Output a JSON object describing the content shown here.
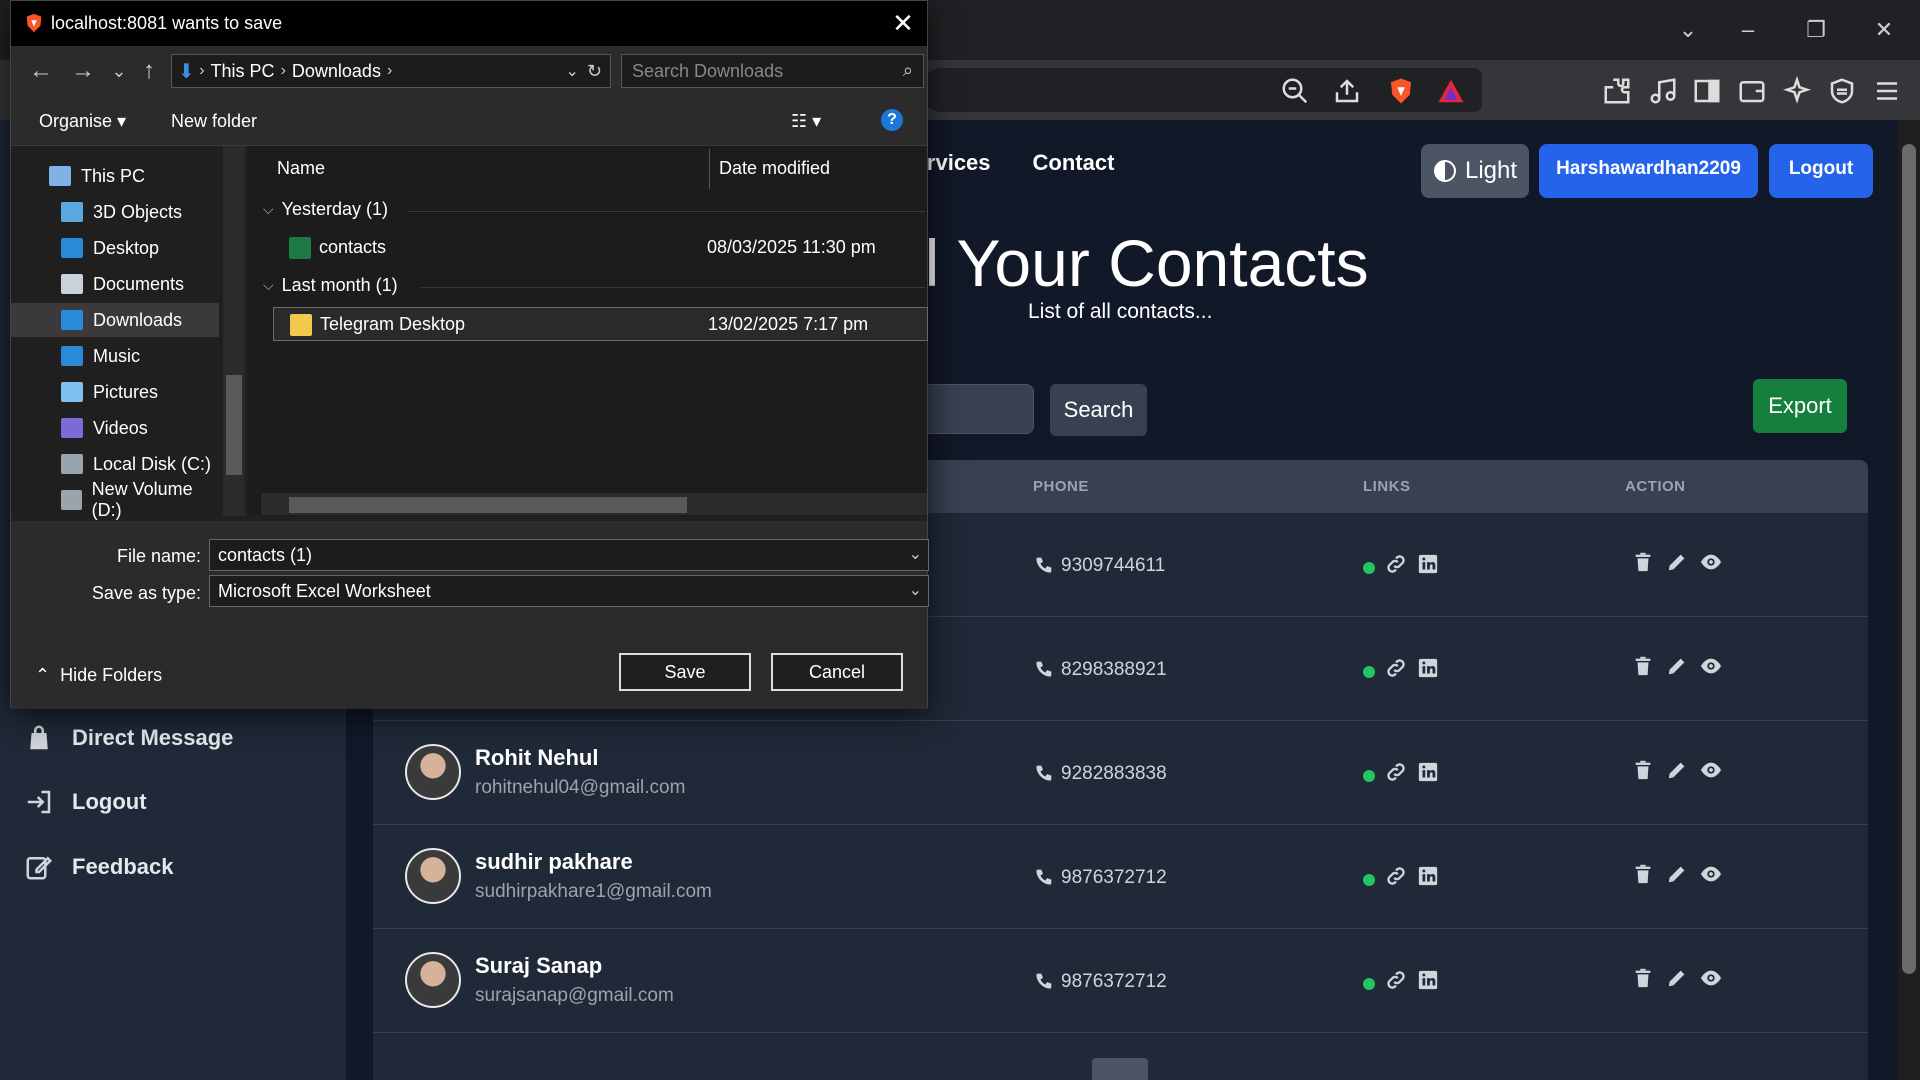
{
  "dialog": {
    "title": "localhost:8081 wants to save",
    "breadcrumb": [
      "This PC",
      "Downloads"
    ],
    "search_placeholder": "Search Downloads",
    "organise_label": "Organise",
    "new_folder_label": "New folder",
    "help_label": "?",
    "nav_items": [
      {
        "label": "This PC",
        "icon": "computer-icon"
      },
      {
        "label": "3D Objects",
        "icon": "3d-objects-icon"
      },
      {
        "label": "Desktop",
        "icon": "desktop-icon"
      },
      {
        "label": "Documents",
        "icon": "documents-icon"
      },
      {
        "label": "Downloads",
        "icon": "downloads-icon"
      },
      {
        "label": "Music",
        "icon": "music-icon"
      },
      {
        "label": "Pictures",
        "icon": "pictures-icon"
      },
      {
        "label": "Videos",
        "icon": "videos-icon"
      },
      {
        "label": "Local Disk (C:)",
        "icon": "drive-icon"
      },
      {
        "label": "New Volume (D:)",
        "icon": "drive-icon"
      }
    ],
    "columns": {
      "name": "Name",
      "date": "Date modified"
    },
    "groups": [
      {
        "label": "Yesterday (1)",
        "files": [
          {
            "name": "contacts",
            "date": "08/03/2025 11:30 pm",
            "icon": "excel-file-icon"
          }
        ]
      },
      {
        "label": "Last month (1)",
        "files": [
          {
            "name": "Telegram Desktop",
            "date": "13/02/2025 7:17 pm",
            "icon": "folder-icon"
          }
        ]
      }
    ],
    "file_name_label": "File name:",
    "file_name_value": "contacts (1)",
    "save_type_label": "Save as type:",
    "save_type_value": "Microsoft Excel Worksheet",
    "save_label": "Save",
    "cancel_label": "Cancel",
    "hide_folders_label": "Hide Folders"
  },
  "app": {
    "nav": {
      "services": "Services",
      "contact": "Contact"
    },
    "theme_label": "Light",
    "user_label": "Harshawardhan2209",
    "logout_label": "Logout",
    "page_title": "ll Your Contacts",
    "page_subtitle": "List of all contacts...",
    "search_label": "Search",
    "export_label": "Export",
    "table_headers": {
      "phone": "PHONE",
      "links": "LINKS",
      "action": "ACTION"
    },
    "sidebar": [
      {
        "label": "Direct Message",
        "icon": "message-icon"
      },
      {
        "label": "Logout",
        "icon": "logout-icon"
      },
      {
        "label": "Feedback",
        "icon": "feedback-icon"
      }
    ],
    "contacts": [
      {
        "name": "",
        "email": "",
        "phone": "9309744611"
      },
      {
        "name": "",
        "email": "",
        "phone": "8298388921"
      },
      {
        "name": "Rohit Nehul",
        "email": "rohitnehul04@gmail.com",
        "phone": "9282883838"
      },
      {
        "name": "sudhir pakhare",
        "email": "sudhirpakhare1@gmail.com",
        "phone": "9876372712"
      },
      {
        "name": "Suraj Sanap",
        "email": "surajsanap@gmail.com",
        "phone": "9876372712"
      }
    ]
  },
  "colors": {
    "primary_button": "#2563eb",
    "export_button": "#15803d",
    "status_dot": "#22c55e",
    "background": "#111827",
    "panel": "#1f2937"
  }
}
